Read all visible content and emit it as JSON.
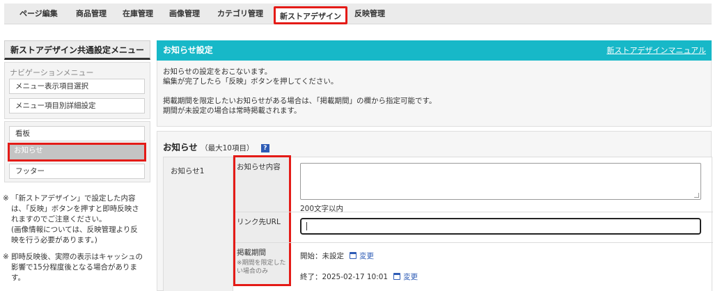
{
  "tabs": [
    "ページ編集",
    "商品管理",
    "在庫管理",
    "画像管理",
    "カテゴリ管理",
    "新ストアデザイン",
    "反映管理"
  ],
  "active_tab": "新ストアデザイン",
  "sidebar": {
    "title": "新ストアデザイン共通設定メニュー",
    "nav_heading": "ナビゲーションメニュー",
    "nav_items": [
      "メニュー表示項目選択",
      "メニュー項目別詳細設定"
    ],
    "content_items": [
      "看板",
      "お知らせ",
      "フッター"
    ],
    "selected_item": "お知らせ",
    "note1_mark": "※",
    "note1_lines": [
      "「新ストアデザイン」で設定した内容",
      "は、「反映」ボタンを押すと即時反映さ",
      "れますのでご注意ください。",
      "(画像情報については、反映管理より反",
      "映を行う必要があります。)"
    ],
    "note2_mark": "※",
    "note2_lines": [
      "即時反映後、実際の表示はキャッシュの",
      "影響で15分程度後となる場合がありま",
      "す。"
    ]
  },
  "main": {
    "title": "お知らせ設定",
    "manual_link": "新ストアデザインマニュアル",
    "info_lines": [
      "お知らせの設定をおこないます。",
      "編集が完了したら「反映」ボタンを押してください。"
    ],
    "info_lines2": [
      "掲載期間を限定したいお知らせがある場合は、「掲載期間」の欄から指定可能です。",
      "期間が未設定の場合は常時掲載されます。"
    ],
    "section_title": "お知らせ",
    "section_sub": "（最大10項目）",
    "help_icon": "?",
    "row_label": "お知らせ1",
    "content_label": "お知らせ内容",
    "char_limit": "200文字以内",
    "url_label": "リンク先URL",
    "period_label": "掲載期間",
    "period_note": "※期間を限定したい場合のみ",
    "start": "開始：未設定",
    "end": "終了：2025-02-17 10:01",
    "change_label": "変更"
  },
  "colors": {
    "accent": "#17b8c8",
    "highlight": "#e41b17",
    "link": "#2d5bb5"
  }
}
